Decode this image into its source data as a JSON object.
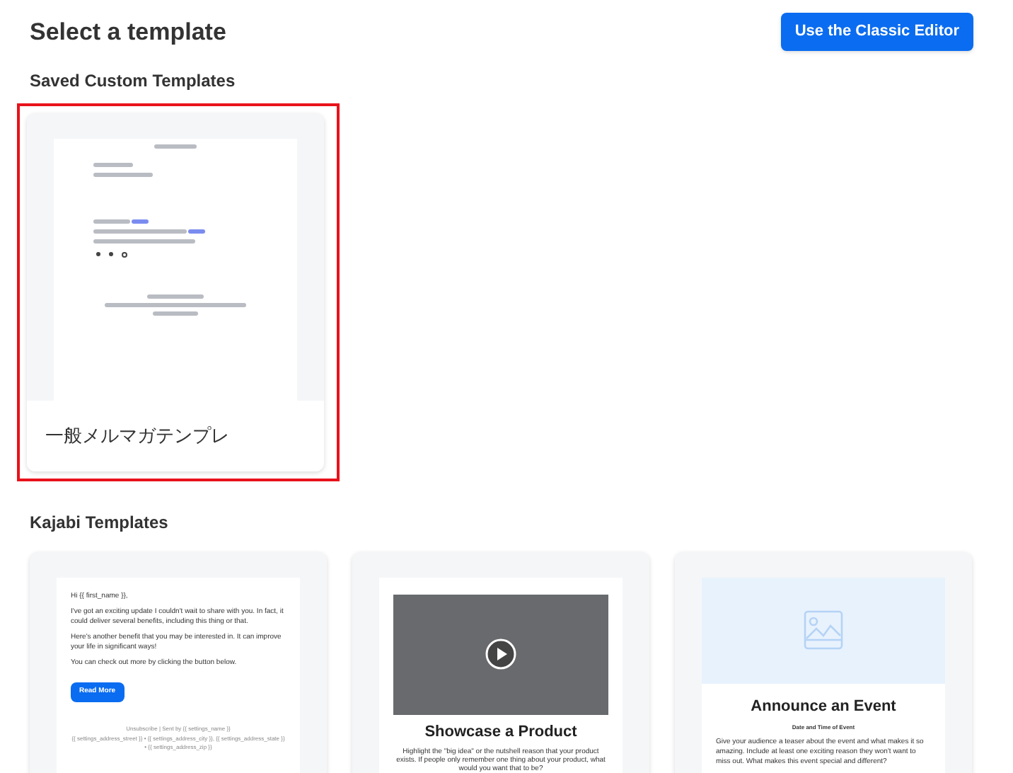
{
  "header": {
    "title": "Select a template",
    "classic_button": "Use the Classic Editor"
  },
  "saved": {
    "heading": "Saved Custom Templates",
    "templates": [
      {
        "name": "一般メルマガテンプレ",
        "selected": true
      }
    ]
  },
  "kajabi": {
    "heading": "Kajabi Templates",
    "templates": [
      {
        "kind": "newsletter",
        "greeting": "Hi {{ first_name }},",
        "paragraphs": [
          "I've got an exciting update I couldn't wait to share with you. In fact, it could deliver several benefits, including this thing or that.",
          "Here's another benefit that you may be interested in. It can improve your life in significant ways!",
          "You can check out more by clicking the button below."
        ],
        "button": "Read More",
        "footer": [
          "Unsubscribe | Sent by {{ settings_name }}",
          "{{ settings_address_street }} • {{ settings_address_city }}, {{ settings_address_state }} • {{ settings_address_zip }}"
        ]
      },
      {
        "kind": "product",
        "title": "Showcase a Product",
        "body": "Highlight the \"big idea\" or the nutshell reason that your product exists. If people only remember one thing about your product, what would you want that to be?"
      },
      {
        "kind": "event",
        "title": "Announce an Event",
        "subtitle": "Date and Time of Event",
        "body": "Give your audience a teaser about the event and what makes it so amazing. Include at least one exciting reason they won't want to miss out. What makes this event special and different?"
      }
    ]
  }
}
